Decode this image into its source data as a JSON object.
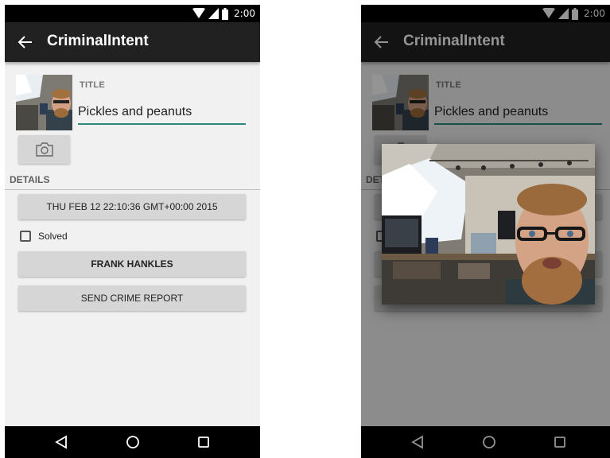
{
  "status_bar": {
    "time": "2:00",
    "icons": [
      "wifi-icon",
      "signal-icon",
      "battery-icon"
    ]
  },
  "app_bar": {
    "title": "CriminalIntent",
    "back_icon": "arrow-left-icon"
  },
  "crime": {
    "title_label": "TITLE",
    "title_value": "Pickles and peanuts",
    "details_header": "DETAILS",
    "date_button": "THU FEB 12 22:10:36 GMT+00:00 2015",
    "solved_label": "Solved",
    "solved": false,
    "suspect_button": "FRANK HANKLES",
    "report_button": "SEND CRIME REPORT",
    "camera_icon": "camera-icon"
  },
  "nav_bar": {
    "icons": [
      "back-triangle-icon",
      "home-circle-icon",
      "recents-square-icon"
    ]
  },
  "photo_dialog": {
    "visible": true,
    "image": "crime-scene-photo-icon"
  },
  "colors": {
    "app_bar": "#212121",
    "accent": "#2e8b7a",
    "screen_bg": "#f1f1f1",
    "button": "#d6d6d6"
  }
}
